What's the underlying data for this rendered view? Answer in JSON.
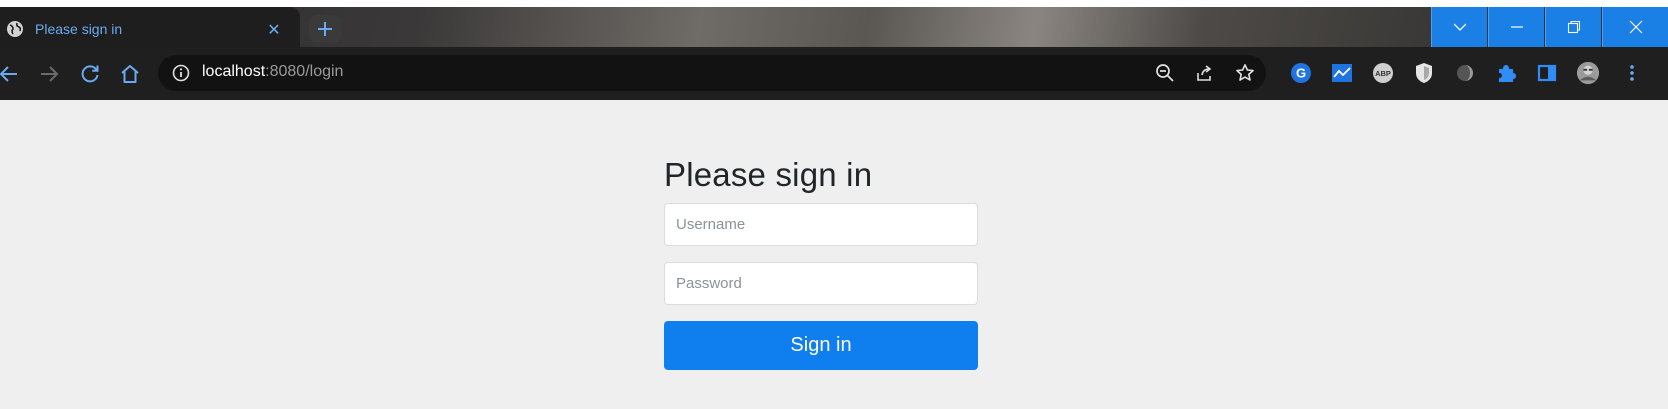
{
  "browser": {
    "tab": {
      "title": "Please sign in",
      "favicon": "globe-icon",
      "close_label": "✕"
    },
    "new_tab_label": "+",
    "address": {
      "host": "localhost",
      "rest": ":8080/login"
    },
    "colors": {
      "accent": "#1a80e6",
      "tab_text": "#6aaaf2",
      "toolbar_bg": "#1f1f1f"
    },
    "extensions": [
      "grammarly-icon",
      "chart-extension-icon",
      "adblock-plus-icon",
      "shield-extension-icon",
      "dark-mode-icon",
      "extensions-puzzle-icon",
      "side-panel-icon",
      "profile-avatar-icon",
      "kebab-menu-icon"
    ],
    "extension_labels": {
      "grammarly": "G",
      "abp": "ABP"
    }
  },
  "login": {
    "heading": "Please sign in",
    "username_placeholder": "Username",
    "password_placeholder": "Password",
    "submit_label": "Sign in",
    "button_color": "#0f7ff0"
  }
}
